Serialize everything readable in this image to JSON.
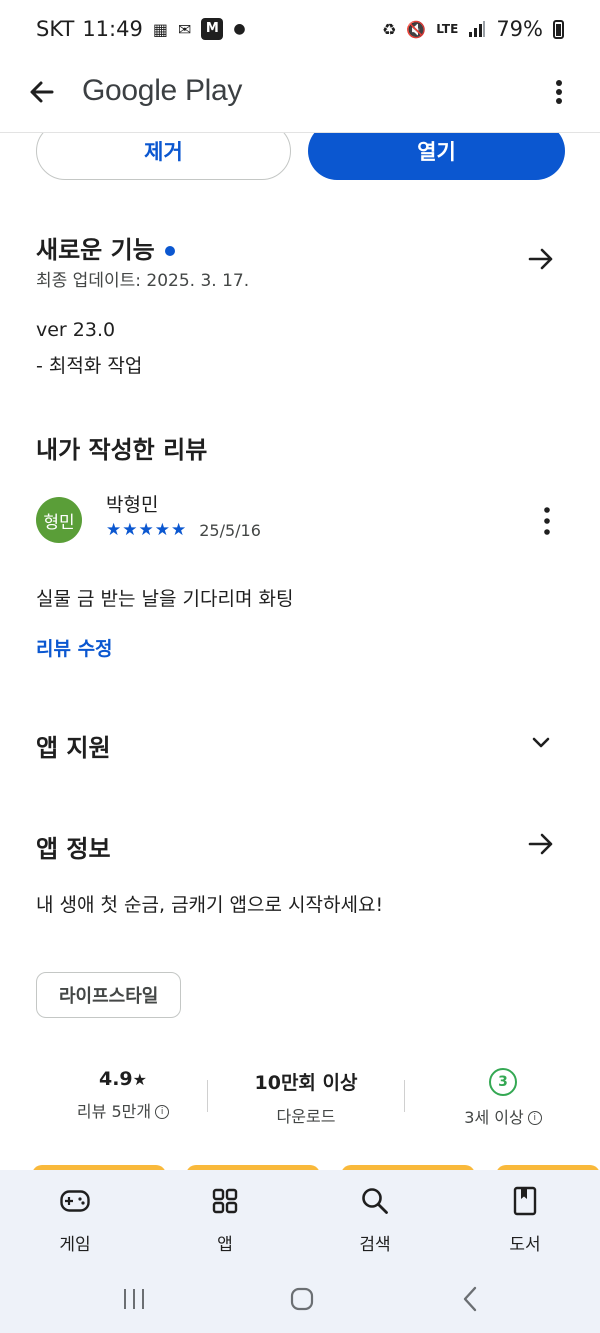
{
  "status_bar": {
    "carrier": "SKT",
    "time": "11:49",
    "network": "LTE",
    "battery": "79%"
  },
  "app_bar": {
    "title": "Google Play"
  },
  "actions": {
    "remove_label": "제거",
    "open_label": "열기"
  },
  "whats_new": {
    "title": "새로운 기능",
    "last_updated": "최종 업데이트: 2025. 3. 17.",
    "version": "ver 23.0",
    "note": "- 최적화 작업"
  },
  "my_review": {
    "title": "내가 작성한 리뷰",
    "avatar_text": "형민",
    "reviewer": "박형민",
    "stars": "★★★★★",
    "rating": 5,
    "date": "25/5/16",
    "text": "실물 금 받는 날을 기다리며 화팅",
    "edit_label": "리뷰 수정"
  },
  "app_support": {
    "title": "앱 지원"
  },
  "app_info": {
    "title": "앱 정보",
    "description": "내 생애 첫 순금, 금캐기 앱으로 시작하세요!",
    "category_chip": "라이프스타일"
  },
  "stats": {
    "rating": "4.9",
    "rating_star": "★",
    "reviews": "리뷰 5만개",
    "downloads": "10만회 이상",
    "downloads_label": "다운로드",
    "age_badge": "3",
    "age_label": "3세 이상"
  },
  "bottom_nav": {
    "items": [
      {
        "label": "게임",
        "icon": "gamepad-icon"
      },
      {
        "label": "앱",
        "icon": "apps-grid-icon"
      },
      {
        "label": "검색",
        "icon": "search-icon"
      },
      {
        "label": "도서",
        "icon": "book-icon"
      }
    ]
  },
  "colors": {
    "accent": "#0b57d0",
    "avatar": "#5a9e38",
    "age_badge": "#34a853",
    "nav_background": "#eef2f9"
  }
}
